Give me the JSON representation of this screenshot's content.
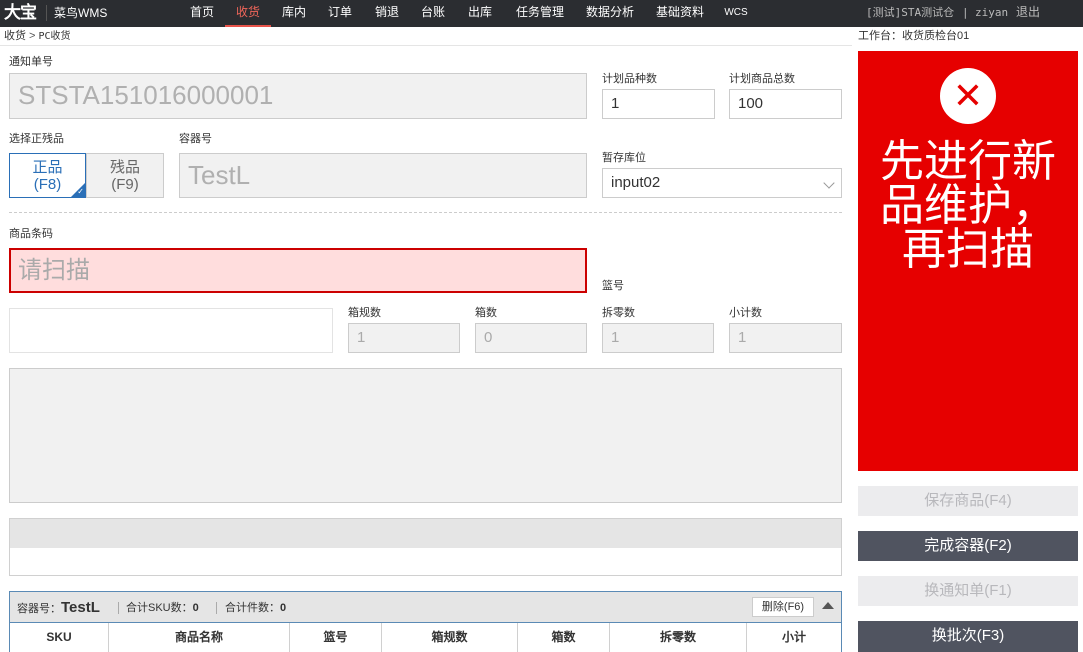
{
  "app": {
    "logo": "大宝",
    "subtitle": "菜鸟WMS"
  },
  "nav": [
    {
      "label": "首页",
      "active": false
    },
    {
      "label": "收货",
      "active": true
    },
    {
      "label": "库内",
      "active": false
    },
    {
      "label": "订单",
      "active": false
    },
    {
      "label": "销退",
      "active": false
    },
    {
      "label": "台账",
      "active": false
    },
    {
      "label": "出库",
      "active": false
    },
    {
      "label": "任务管理",
      "active": false
    },
    {
      "label": "数据分析",
      "active": false
    },
    {
      "label": "基础资料",
      "active": false
    },
    {
      "label": "WCS",
      "active": false
    }
  ],
  "user": {
    "warehouse": "[测试]STA测试仓",
    "separator": "|",
    "name": "ziyan",
    "logout": "退出"
  },
  "breadcrumb": {
    "first": "收货",
    "sep": ">",
    "second": "PC收货"
  },
  "workstation": "工作台：收货质检台01",
  "form": {
    "notice_label": "通知单号",
    "notice_value": "STSTA151016000001",
    "plan_variety_label": "计划品种数",
    "plan_variety_value": "1",
    "plan_total_label": "计划商品总数",
    "plan_total_value": "100",
    "quality_label": "选择正残品",
    "quality_good": "正品",
    "quality_good_key": "(F8)",
    "quality_bad": "残品",
    "quality_bad_key": "(F9)",
    "container_label": "容器号",
    "container_value": "TestL",
    "temp_loc_label": "暂存库位",
    "temp_loc_value": "input02",
    "barcode_label": "商品条码",
    "barcode_placeholder": "请扫描",
    "basket_label": "篮号",
    "box_spec_label": "箱规数",
    "box_spec_value": "1",
    "box_count_label": "箱数",
    "box_count_value": "0",
    "loose_label": "拆零数",
    "loose_value": "1",
    "subtotal_label": "小计数",
    "subtotal_value": "1"
  },
  "container_bar": {
    "container_label": "容器号：",
    "container_value": "TestL",
    "sku_label": "合计SKU数：",
    "sku_value": "0",
    "pieces_label": "合计件数：",
    "pieces_value": "0",
    "delete_label": "删除(F6)"
  },
  "table_columns": [
    "SKU",
    "商品名称",
    "篮号",
    "箱规数",
    "箱数",
    "拆零数",
    "小计"
  ],
  "alert": {
    "message": "先进行新品维护，再扫描"
  },
  "side_buttons": {
    "save": "保存商品(F4)",
    "finish": "完成容器(F2)",
    "switch_notice": "换通知单(F1)",
    "switch_batch": "换批次(F3)"
  },
  "colors": {
    "alert": "#e60000",
    "active_nav": "#e8534a",
    "toggle_on": "#2a6fb7",
    "topbar": "#2b2d31"
  }
}
